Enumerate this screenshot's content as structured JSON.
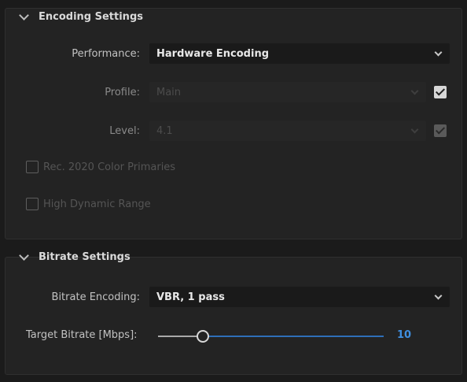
{
  "encoding_settings": {
    "title": "Encoding Settings",
    "performance": {
      "label": "Performance:",
      "value": "Hardware Encoding"
    },
    "profile": {
      "label": "Profile:",
      "value": "Main",
      "checked": true
    },
    "level": {
      "label": "Level:",
      "value": "4.1",
      "checked": true
    },
    "rec2020": {
      "label": "Rec. 2020 Color Primaries",
      "checked": false
    },
    "hdr": {
      "label": "High Dynamic Range",
      "checked": false
    }
  },
  "bitrate_settings": {
    "title": "Bitrate Settings",
    "bitrate_encoding": {
      "label": "Bitrate Encoding:",
      "value": "VBR, 1 pass"
    },
    "target_bitrate": {
      "label": "Target Bitrate [Mbps]:",
      "value": "10",
      "fraction": 0.2
    }
  },
  "colors": {
    "accent": "#3f8fe0",
    "track_fill": "#a9a9a9",
    "track_rest": "#2e6fb8"
  }
}
